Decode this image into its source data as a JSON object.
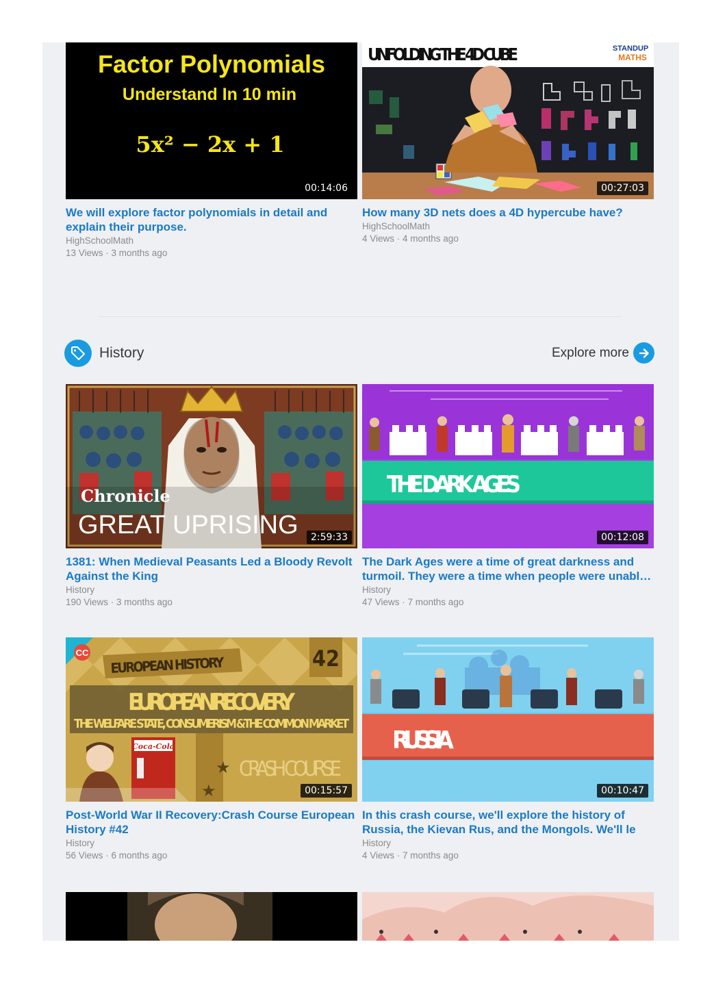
{
  "math_videos": [
    {
      "title": "We will explore factor polynomials in detail and explain their purpose.",
      "channel": "HighSchoolMath",
      "meta": "13 Views · 3 months ago",
      "duration": "00:14:06",
      "thumb_text": {
        "line1": "Factor Polynomials",
        "line2": "Understand In 10 min",
        "formula": "5x² − 2x + 1"
      }
    },
    {
      "title": "How many 3D nets does a 4D hypercube have?",
      "channel": "HighSchoolMath",
      "meta": "4 Views · 4 months ago",
      "duration": "00:27:03",
      "thumb_text": {
        "headline": "UNFOLDING THE 4D CUBE",
        "logo_top": "STANDUP",
        "logo_bottom": "MATHS"
      }
    }
  ],
  "history_section": {
    "title": "History",
    "explore_label": "Explore more",
    "videos": [
      {
        "title": "1381: When Medieval Peasants Led a Bloody Revolt Against the King",
        "channel": "History",
        "meta": "190 Views · 3 months ago",
        "duration": "2:59:33",
        "thumb_text": {
          "brand": "Chronicle",
          "headline": "GREAT UPRISING"
        }
      },
      {
        "title": "The Dark Ages were a time of great darkness and turmoil. They were a time when people were unable to read or write.",
        "channel": "History",
        "meta": "47 Views · 7 months ago",
        "duration": "00:12:08",
        "thumb_text": {
          "headline": "THE DARK AGES"
        }
      },
      {
        "title": "Post-World War II Recovery:Crash Course European History #42",
        "channel": "History",
        "meta": "56 Views · 6 months ago",
        "duration": "00:15:57",
        "thumb_text": {
          "badge": "CC",
          "number": "42",
          "series": "EUROPEAN HISTORY",
          "headline": "EUROPEAN RECOVERY",
          "subtitle": "THE WELFARE STATE, CONSUMERISM &THE COMMON MARKET",
          "watermark": "CRASH COURSE",
          "sign": "Coca-Cola"
        }
      },
      {
        "title": "In this crash course, we'll explore the history of Russia, the Kievan Rus, and the Mongols. We'll le",
        "channel": "History",
        "meta": "4 Views · 7 months ago",
        "duration": "00:10:47",
        "thumb_text": {
          "headline": "RUSSIA"
        }
      }
    ]
  },
  "colors": {
    "accent": "#1a9be0",
    "link": "#1a7ac4",
    "panel_bg": "#eef0f4"
  },
  "icons": {
    "section_tag": "tag-icon",
    "explore": "arrow-right-icon"
  }
}
